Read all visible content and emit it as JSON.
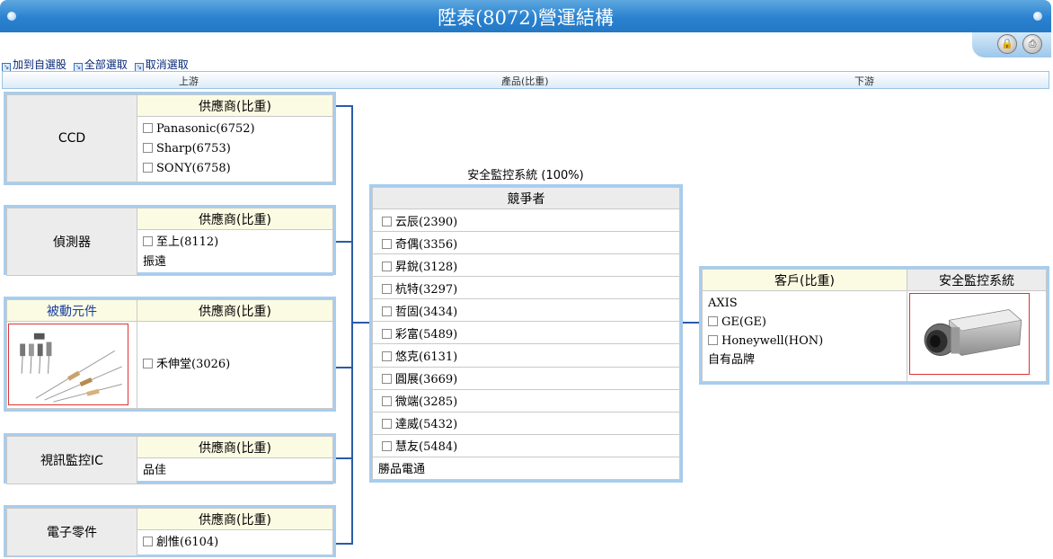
{
  "window": {
    "title": "陞泰(8072)營運結構"
  },
  "actions": {
    "add": "加到自選股",
    "select_all": "全部選取",
    "deselect": "取消選取"
  },
  "columns": {
    "upstream": "上游",
    "product": "產品(比重)",
    "downstream": "下游"
  },
  "supplier_header": "供應商(比重)",
  "upstream": [
    {
      "label": "CCD",
      "suppliers": [
        "Panasonic(6752)",
        "Sharp(6753)",
        "SONY(6758)"
      ]
    },
    {
      "label": "偵測器",
      "suppliers": [
        "至上(8112)"
      ],
      "plain": [
        "振遠"
      ]
    },
    {
      "label": "被動元件",
      "suppliers": [
        "禾伸堂(3026)"
      ]
    },
    {
      "label": "視訊監控IC",
      "plain": [
        "品佳"
      ]
    },
    {
      "label": "電子零件",
      "suppliers": [
        "創惟(6104)"
      ]
    }
  ],
  "product": {
    "title": "安全監控系統 (100%)",
    "competitor_header": "競爭者",
    "competitors": [
      "云辰(2390)",
      "奇偶(3356)",
      "昇銳(3128)",
      "杭特(3297)",
      "哲固(3434)",
      "彩富(5489)",
      "悠克(6131)",
      "圓展(3669)",
      "微端(3285)",
      "達威(5432)",
      "慧友(5484)"
    ],
    "plain": "勝品電通"
  },
  "downstream": {
    "customer_header": "客戶(比重)",
    "image_header": "安全監控系統",
    "plain_top": "AXIS",
    "customers": [
      "GE(GE)",
      "Honeywell(HON)"
    ],
    "plain_bottom": "自有品牌"
  }
}
